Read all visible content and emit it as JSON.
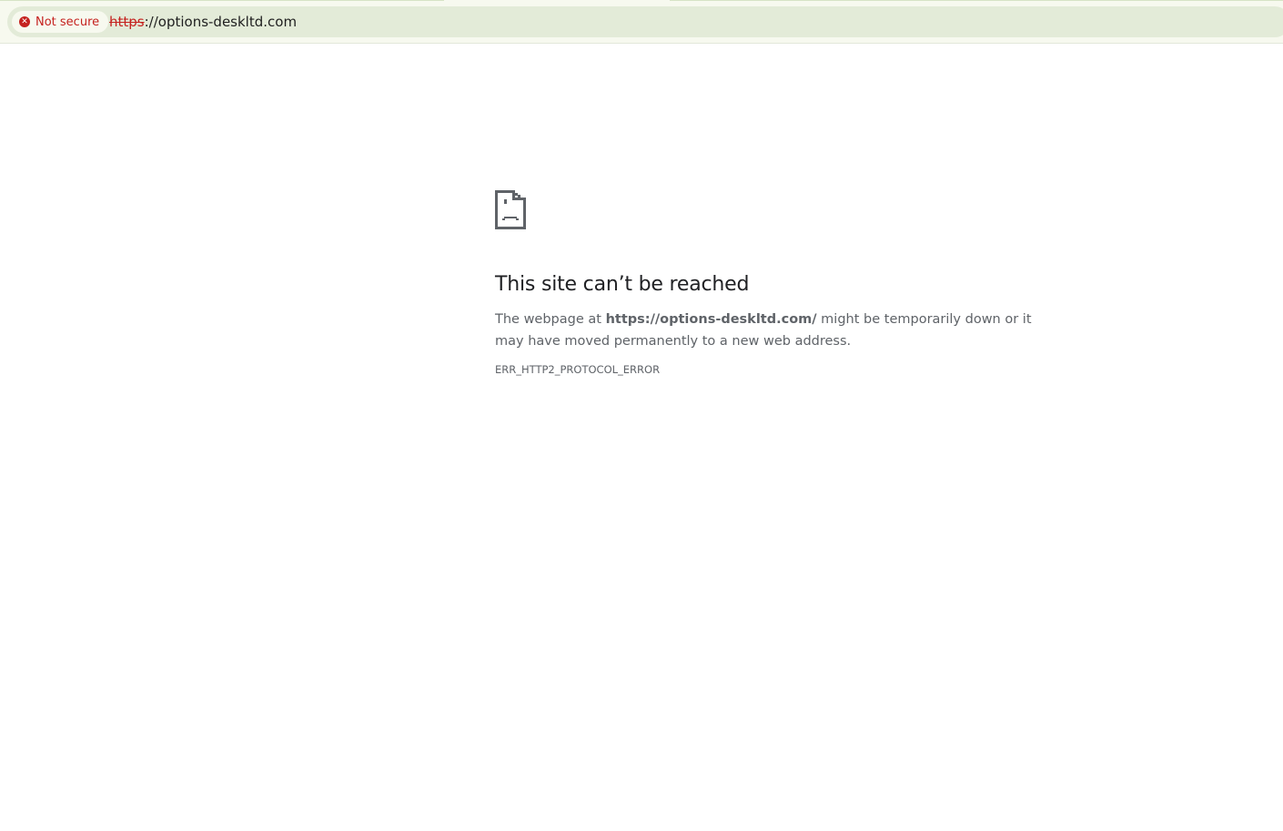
{
  "browser": {
    "security_label": "Not secure",
    "security_icon": "error-circle-icon",
    "url_scheme": "https",
    "url_rest": "://options-deskltd.com"
  },
  "error": {
    "icon": "sad-file-icon",
    "title": "This site can’t be reached",
    "desc_prefix": "The webpage at ",
    "desc_url": "https://options-deskltd.com/",
    "desc_suffix": " might be temporarily down or it may have moved permanently to a new web address.",
    "code": "ERR_HTTP2_PROTOCOL_ERROR"
  },
  "colors": {
    "danger": "#c5221f",
    "omnibox_bg": "#e3ebd8",
    "text": "#5f6368"
  }
}
